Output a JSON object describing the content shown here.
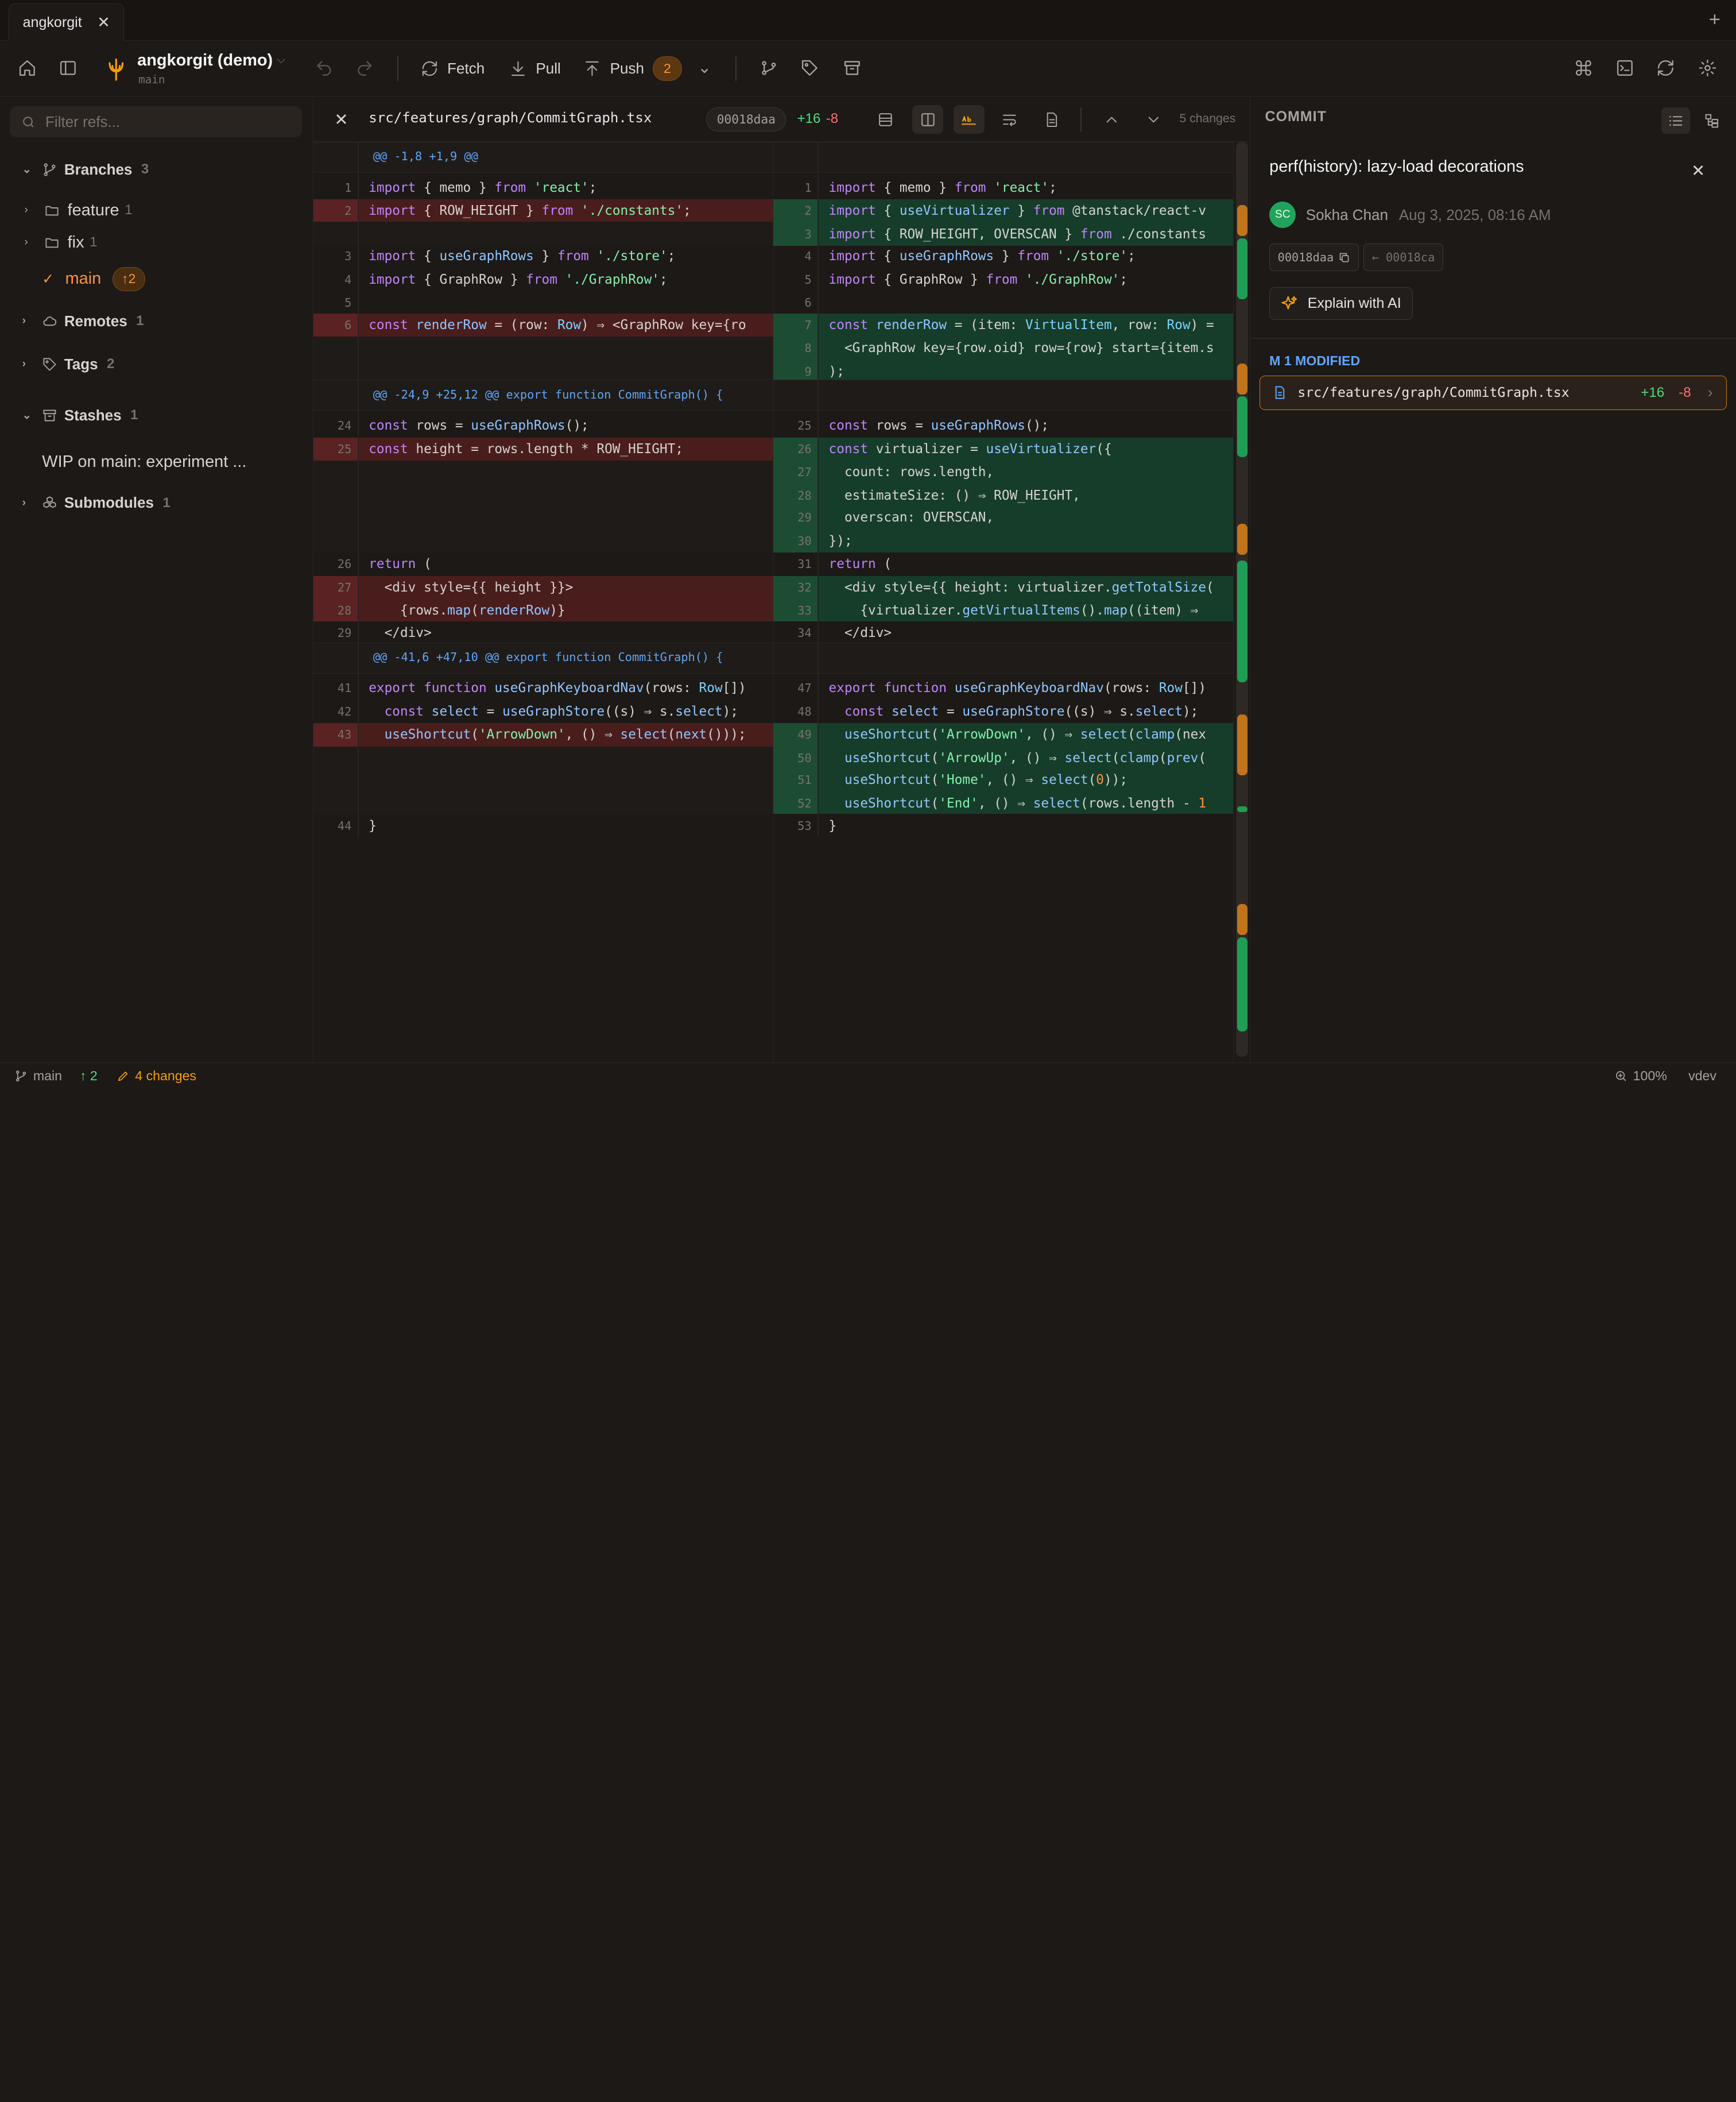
{
  "window": {
    "tab_title": "angkorgit",
    "tab_close": "✕",
    "new_tab": "+"
  },
  "toolbar": {
    "repo_name": "angkorgit (demo)",
    "repo_branch": "main",
    "repo_chevron": "⌵",
    "fetch_label": "Fetch",
    "pull_label": "Pull",
    "push_label": "Push",
    "push_count": "2",
    "more_chevron": "⌄"
  },
  "sidebar": {
    "filter_placeholder": "Filter refs...",
    "branches": {
      "label": "Branches",
      "count": "3"
    },
    "folders": [
      {
        "label": "feature",
        "count": "1"
      },
      {
        "label": "fix",
        "count": "1"
      }
    ],
    "main_branch": {
      "label": "main",
      "ahead": "↑2"
    },
    "remotes": {
      "label": "Remotes",
      "count": "1"
    },
    "tags": {
      "label": "Tags",
      "count": "2"
    },
    "stashes": {
      "label": "Stashes",
      "count": "1"
    },
    "stash_item": "WIP on main: experiment ...",
    "submodules": {
      "label": "Submodules",
      "count": "1"
    }
  },
  "diff": {
    "file_path": "src/features/graph/CommitGraph.tsx",
    "sha": "00018daa",
    "additions": "+16",
    "deletions": "-8",
    "changes_label": "5 changes",
    "hunks": [
      "@@ -1,8 +1,9 @@",
      "@@ -24,9 +25,12 @@ export function CommitGraph() {",
      "@@ -41,6 +47,10 @@ export function CommitGraph() {"
    ],
    "left_lines": [
      {
        "n": "1",
        "t": "import { memo } from 'react';"
      },
      {
        "n": "2",
        "t": "import { ROW_HEIGHT } from './constants';"
      },
      {
        "n": "3",
        "t": "import { useGraphRows } from './store';"
      },
      {
        "n": "4",
        "t": "import { GraphRow } from './GraphRow';"
      },
      {
        "n": "5",
        "t": ""
      },
      {
        "n": "6",
        "t": "const renderRow = (row: Row) ⇒ <GraphRow key={ro"
      },
      {
        "n": "24",
        "t": "const rows = useGraphRows();"
      },
      {
        "n": "25",
        "t": "const height = rows.length * ROW_HEIGHT;"
      },
      {
        "n": "26",
        "t": "return ("
      },
      {
        "n": "27",
        "t": "  <div style={{ height }}>"
      },
      {
        "n": "28",
        "t": "    {rows.map(renderRow)}"
      },
      {
        "n": "29",
        "t": "  </div>"
      },
      {
        "n": "41",
        "t": "export function useGraphKeyboardNav(rows: Row[])"
      },
      {
        "n": "42",
        "t": "  const select = useGraphStore((s) ⇒ s.select);"
      },
      {
        "n": "43",
        "t": "  useShortcut('ArrowDown', () ⇒ select(next()));"
      },
      {
        "n": "44",
        "t": "}"
      }
    ],
    "right_lines": [
      {
        "n": "1",
        "t": "import { memo } from 'react';"
      },
      {
        "n": "2",
        "t": "import { useVirtualizer } from '@tanstack/react-v"
      },
      {
        "n": "3",
        "t": "import { ROW_HEIGHT, OVERSCAN } from './constants"
      },
      {
        "n": "4",
        "t": "import { useGraphRows } from './store';"
      },
      {
        "n": "5",
        "t": "import { GraphRow } from './GraphRow';"
      },
      {
        "n": "6",
        "t": ""
      },
      {
        "n": "7",
        "t": "const renderRow = (item: VirtualItem, row: Row) ="
      },
      {
        "n": "8",
        "t": "  <GraphRow key={row.oid} row={row} start={item.s"
      },
      {
        "n": "9",
        "t": ");"
      },
      {
        "n": "25",
        "t": "const rows = useGraphRows();"
      },
      {
        "n": "26",
        "t": "const virtualizer = useVirtualizer({"
      },
      {
        "n": "27",
        "t": "  count: rows.length,"
      },
      {
        "n": "28",
        "t": "  estimateSize: () ⇒ ROW_HEIGHT,"
      },
      {
        "n": "29",
        "t": "  overscan: OVERSCAN,"
      },
      {
        "n": "30",
        "t": "});"
      },
      {
        "n": "31",
        "t": "return ("
      },
      {
        "n": "32",
        "t": "  <div style={{ height: virtualizer.getTotalSize("
      },
      {
        "n": "33",
        "t": "    {virtualizer.getVirtualItems().map((item) ⇒"
      },
      {
        "n": "34",
        "t": "  </div>"
      },
      {
        "n": "47",
        "t": "export function useGraphKeyboardNav(rows: Row[])"
      },
      {
        "n": "48",
        "t": "  const select = useGraphStore((s) ⇒ s.select);"
      },
      {
        "n": "49",
        "t": "  useShortcut('ArrowDown', () ⇒ select(clamp(nex"
      },
      {
        "n": "50",
        "t": "  useShortcut('ArrowUp', () ⇒ select(clamp(prev("
      },
      {
        "n": "51",
        "t": "  useShortcut('Home', () ⇒ select(0));"
      },
      {
        "n": "52",
        "t": "  useShortcut('End', () ⇒ select(rows.length - 1"
      },
      {
        "n": "53",
        "t": "}"
      }
    ]
  },
  "commit": {
    "panel_title": "COMMIT",
    "message": "perf(history): lazy-load decorations",
    "avatar_initials": "SC",
    "author": "Sokha Chan",
    "date": "Aug 3, 2025, 08:16 AM",
    "sha": "00018daa",
    "parent": "← 00018ca",
    "explain_label": "Explain with AI",
    "modified_header": "M 1 MODIFIED",
    "file": {
      "path": "src/features/graph/CommitGraph.tsx",
      "additions": "+16",
      "deletions": "-8"
    }
  },
  "status": {
    "branch": "main",
    "ahead": "↑ 2",
    "changes": "4 changes",
    "zoom": "100%",
    "env": "vdev"
  },
  "colors": {
    "accent": "#f59e0b",
    "added_bg": "#163d2a",
    "removed_bg": "#4a1d1d",
    "link": "#60a5fa"
  }
}
